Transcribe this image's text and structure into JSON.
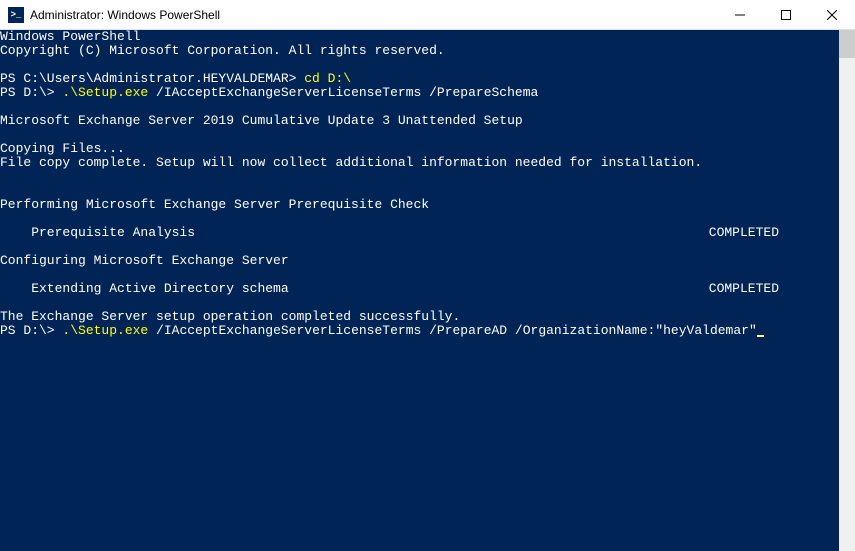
{
  "window": {
    "title": "Administrator: Windows PowerShell",
    "icon_label": ">_"
  },
  "terminal": {
    "header1": "Windows PowerShell",
    "header2": "Copyright (C) Microsoft Corporation. All rights reserved.",
    "prompt1": "PS C:\\Users\\Administrator.HEYVALDEMAR> ",
    "cmd1": "cd D:\\",
    "prompt2": "PS D:\\> ",
    "cmd2_part1": ".\\Setup.exe",
    "cmd2_part2": " /IAcceptExchangeServerLicenseTerms /PrepareSchema",
    "setup_title": "Microsoft Exchange Server 2019 Cumulative Update 3 Unattended Setup",
    "copying": "Copying Files...",
    "filecopy": "File copy complete. Setup will now collect additional information needed for installation.",
    "prereq_header": "Performing Microsoft Exchange Server Prerequisite Check",
    "prereq_item": "    Prerequisite Analysis",
    "prereq_status": "COMPLETED",
    "config_header": "Configuring Microsoft Exchange Server",
    "config_item": "    Extending Active Directory schema",
    "config_status": "COMPLETED",
    "success": "The Exchange Server setup operation completed successfully.",
    "prompt3": "PS D:\\> ",
    "cmd3_part1": ".\\Setup.exe",
    "cmd3_part2": " /IAcceptExchangeServerLicenseTerms /PrepareAD /OrganizationName:\"heyValdemar\""
  }
}
